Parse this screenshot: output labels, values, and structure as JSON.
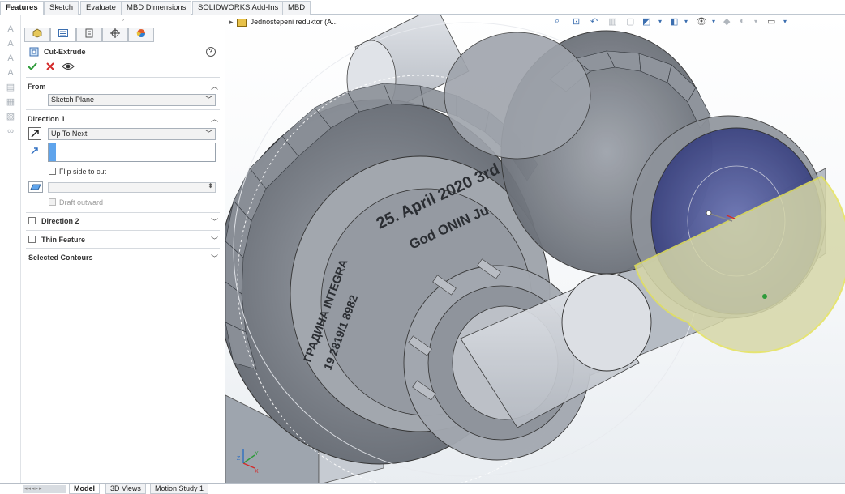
{
  "top_tabs": [
    "Features",
    "Sketch",
    "Evaluate",
    "MBD Dimensions",
    "SOLIDWORKS Add-Ins",
    "MBD"
  ],
  "property_manager": {
    "title": "Cut-Extrude",
    "help_icon": "?",
    "from": {
      "header": "From",
      "value": "Sketch Plane"
    },
    "direction1": {
      "header": "Direction 1",
      "end_condition": "Up To Next",
      "flip_side_label": "Flip side to cut",
      "draft_label": "Draft outward"
    },
    "direction2_label": "Direction 2",
    "thin_feature_label": "Thin Feature",
    "selected_contours_label": "Selected Contours"
  },
  "viewport": {
    "tree_item_label": "Jednostepeni reduktor  (A...",
    "engraving_lines": [
      "25. April 2020 3rd",
      "God ONIN Ju",
      "ГРАДИНА INTEGRA",
      "19 2819/1 8982"
    ]
  },
  "bottom_tabs": [
    "Model",
    "3D Views",
    "Motion Study 1"
  ],
  "icons": {
    "ok": "check-icon",
    "cancel": "close-icon",
    "preview": "eye-icon",
    "collapse": "chevron-up-icon",
    "expand": "chevron-down-icon"
  },
  "colors": {
    "ok_green": "#2e9b3a",
    "cancel_red": "#d42a2a",
    "selection_yellow": "#e4e25a",
    "face_blue": "#3d4a94",
    "accent_blue": "#3c6fb0"
  }
}
